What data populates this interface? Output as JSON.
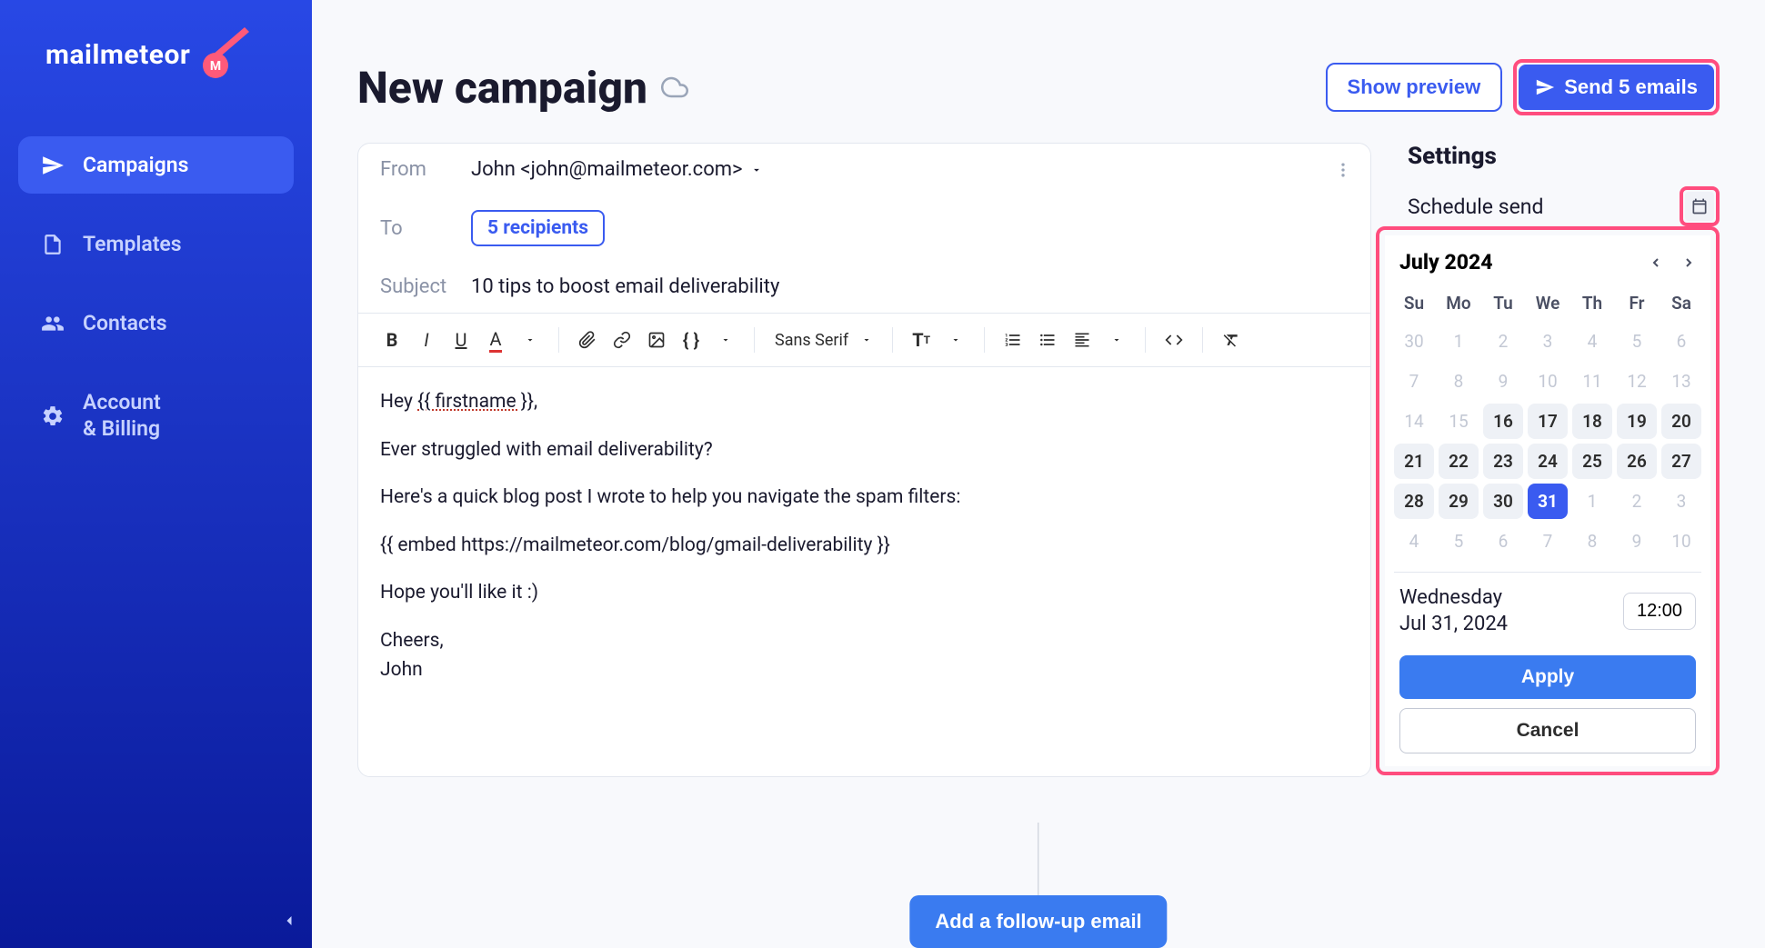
{
  "brand": {
    "name": "mailmeteor"
  },
  "sidebar": {
    "items": [
      {
        "label": "Campaigns",
        "active": true
      },
      {
        "label": "Templates",
        "active": false
      },
      {
        "label": "Contacts",
        "active": false
      },
      {
        "label": "Account\n& Billing",
        "active": false
      }
    ]
  },
  "header": {
    "title": "New campaign",
    "preview_label": "Show preview",
    "send_label": "Send 5 emails"
  },
  "compose": {
    "from_label": "From",
    "from_value": "John <john@mailmeteor.com>",
    "to_label": "To",
    "recipients_chip": "5 recipients",
    "subject_label": "Subject",
    "subject_value": "10 tips to boost email deliverability",
    "toolbar": {
      "font": "Sans Serif"
    },
    "body": {
      "line1_pre": "Hey ",
      "line1_tag": "{{ firstname }}",
      "line1_post": ",",
      "line2": "Ever struggled with email deliverability?",
      "line3": "Here's a quick blog post I wrote to help you navigate the spam filters:",
      "line4": "{{ embed https://mailmeteor.com/blog/gmail-deliverability }}",
      "line5": "Hope you'll like it :)",
      "line6a": "Cheers,",
      "line6b": "John"
    }
  },
  "settings": {
    "title": "Settings",
    "schedule_label": "Schedule send"
  },
  "calendar": {
    "month_label": "July 2024",
    "dow": [
      "Su",
      "Mo",
      "Tu",
      "We",
      "Th",
      "Fr",
      "Sa"
    ],
    "days": [
      {
        "n": "30",
        "muted": true
      },
      {
        "n": "1",
        "muted": true
      },
      {
        "n": "2",
        "muted": true
      },
      {
        "n": "3",
        "muted": true
      },
      {
        "n": "4",
        "muted": true
      },
      {
        "n": "5",
        "muted": true
      },
      {
        "n": "6",
        "muted": true
      },
      {
        "n": "7",
        "muted": true
      },
      {
        "n": "8",
        "muted": true
      },
      {
        "n": "9",
        "muted": true
      },
      {
        "n": "10",
        "muted": true
      },
      {
        "n": "11",
        "muted": true
      },
      {
        "n": "12",
        "muted": true
      },
      {
        "n": "13",
        "muted": true
      },
      {
        "n": "14",
        "muted": true
      },
      {
        "n": "15",
        "muted": true
      },
      {
        "n": "16",
        "in": true
      },
      {
        "n": "17",
        "in": true
      },
      {
        "n": "18",
        "in": true
      },
      {
        "n": "19",
        "in": true
      },
      {
        "n": "20",
        "in": true
      },
      {
        "n": "21",
        "in": true
      },
      {
        "n": "22",
        "in": true
      },
      {
        "n": "23",
        "in": true
      },
      {
        "n": "24",
        "in": true
      },
      {
        "n": "25",
        "in": true
      },
      {
        "n": "26",
        "in": true
      },
      {
        "n": "27",
        "in": true
      },
      {
        "n": "28",
        "in": true
      },
      {
        "n": "29",
        "in": true
      },
      {
        "n": "30",
        "in": true
      },
      {
        "n": "31",
        "sel": true
      },
      {
        "n": "1",
        "muted": true
      },
      {
        "n": "2",
        "muted": true
      },
      {
        "n": "3",
        "muted": true
      },
      {
        "n": "4",
        "muted": true
      },
      {
        "n": "5",
        "muted": true
      },
      {
        "n": "6",
        "muted": true
      },
      {
        "n": "7",
        "muted": true
      },
      {
        "n": "8",
        "muted": true
      },
      {
        "n": "9",
        "muted": true
      },
      {
        "n": "10",
        "muted": true
      }
    ],
    "selected_dow": "Wednesday",
    "selected_date": "Jul 31, 2024",
    "time": "12:00",
    "apply_label": "Apply",
    "cancel_label": "Cancel"
  },
  "followup": {
    "label": "Add a follow-up email"
  }
}
